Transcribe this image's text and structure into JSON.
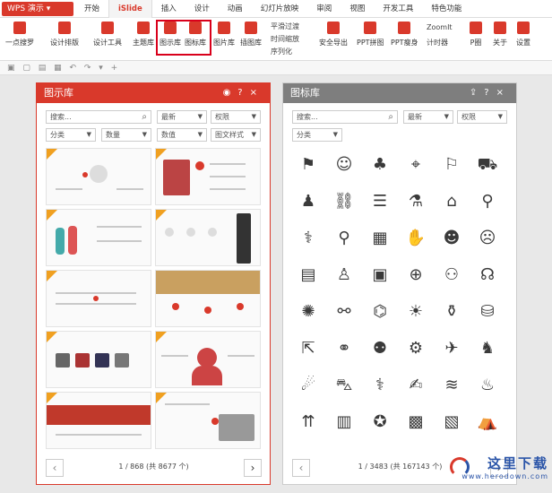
{
  "app": {
    "badge": "WPS 演示",
    "caret": "▾"
  },
  "tabs": [
    "开始",
    "iSlide",
    "插入",
    "设计",
    "动画",
    "幻灯片放映",
    "审阅",
    "视图",
    "开发工具",
    "特色功能"
  ],
  "active_tab": "iSlide",
  "ribbon": {
    "buttons": [
      {
        "label": "一点搜罗",
        "icon": "person-icon"
      },
      {
        "label": "设计排版",
        "icon": "grid-icon"
      },
      {
        "label": "设计工具",
        "icon": "toolbox-icon"
      },
      {
        "label": "主题库",
        "icon": "theme-icon"
      },
      {
        "label": "图示库",
        "icon": "diagram-lib-icon"
      },
      {
        "label": "图标库",
        "icon": "icon-lib-icon"
      },
      {
        "label": "图片库",
        "icon": "picture-lib-icon"
      },
      {
        "label": "插图库",
        "icon": "illustration-lib-icon"
      },
      {
        "label": "安全导出",
        "icon": "export-icon"
      },
      {
        "label": "PPT拼图",
        "icon": "puzzle-icon"
      },
      {
        "label": "PPT瘦身",
        "icon": "slim-icon"
      },
      {
        "label": "P圈",
        "icon": "p-circle-icon"
      },
      {
        "label": "关于",
        "icon": "about-icon"
      },
      {
        "label": "设置",
        "icon": "settings-icon"
      }
    ],
    "small": {
      "smooth": "平滑过渡",
      "timer_zoom": "时间缩放",
      "serialize": "序列化",
      "zoomit": "ZoomIt",
      "timer": "计时器"
    }
  },
  "left_panel": {
    "title": "图示库",
    "search_placeholder": "搜索...",
    "filters1": [
      "最新",
      "权限"
    ],
    "filters2": [
      "分类",
      "数量",
      "数值",
      "图文样式"
    ],
    "pager": "1 / 868 (共 8677 个)"
  },
  "right_panel": {
    "title": "图标库",
    "search_placeholder": "搜索...",
    "filters1": [
      "最新",
      "权限"
    ],
    "filters2": [
      "分类"
    ],
    "pager": "1 / 3483 (共 167143 个)",
    "icons": [
      "⚑",
      "☺",
      "♣",
      "⌖",
      "⚐",
      "⛟",
      "♟",
      "⛓",
      "☰",
      "⚗",
      "⌂",
      "⚲",
      "⚕",
      "⚲",
      "▦",
      "✋",
      "☻",
      "☹",
      "▤",
      "♙",
      "▣",
      "⊕",
      "⚇",
      "☊",
      "✺",
      "⚯",
      "⌬",
      "☀",
      "⚱",
      "⛁",
      "⇱",
      "⚭",
      "⚉",
      "⚙",
      "✈",
      "♞",
      "☄",
      "⛍",
      "⚕",
      "✍",
      "≋",
      "♨",
      "⇈",
      "▥",
      "✪",
      "▩",
      "▧",
      "⛺"
    ]
  },
  "watermark": {
    "title": "这里下载",
    "url": "www.herodown.com"
  }
}
